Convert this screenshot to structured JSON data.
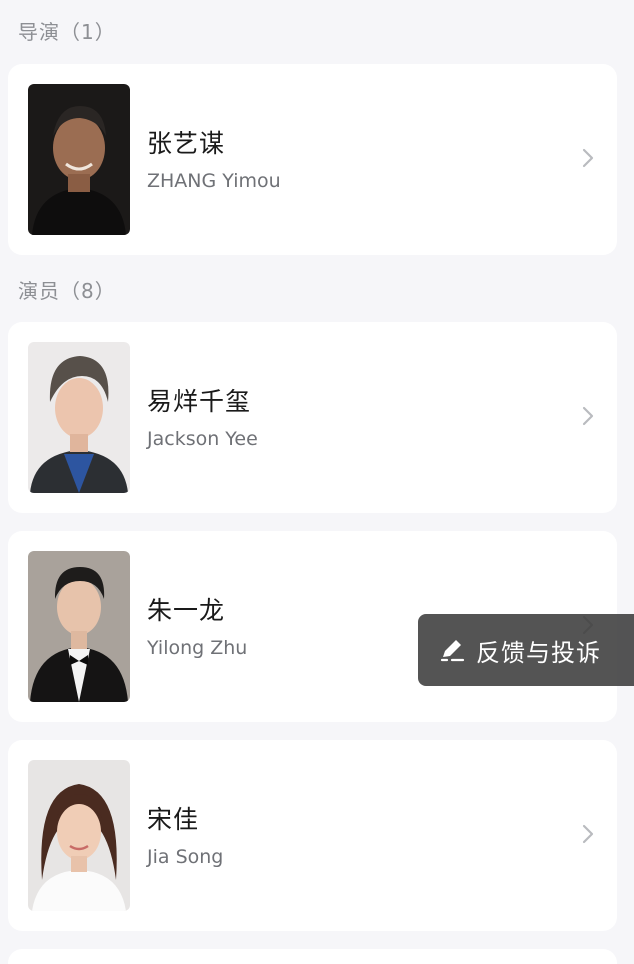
{
  "sections": {
    "director_header": "导演（1）",
    "cast_header": "演员（8）"
  },
  "director": {
    "name_cn": "张艺谋",
    "name_en": "ZHANG Yimou"
  },
  "cast": [
    {
      "name_cn": "易烊千玺",
      "name_en": "Jackson Yee"
    },
    {
      "name_cn": "朱一龙",
      "name_en": "Yilong Zhu"
    },
    {
      "name_cn": "宋佳",
      "name_en": "Jia Song"
    }
  ],
  "feedback": {
    "label": "反馈与投诉",
    "icon": "edit-pencil-icon"
  },
  "colors": {
    "background": "#f6f6f9",
    "card": "#ffffff",
    "section_text": "#8d8f94",
    "primary_text": "#1a1a1a",
    "secondary_text": "#6f7176",
    "chevron": "#b9bbbf",
    "feedback_bg": "#3c3c3c"
  }
}
